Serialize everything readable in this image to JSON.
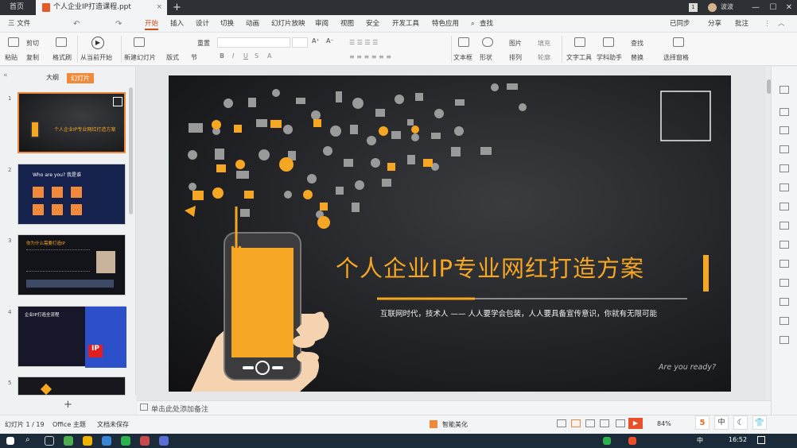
{
  "titlebar": {
    "home_tab": "首页",
    "doc_tab": "个人企业IP打造课程.ppt",
    "new_tab": "+",
    "page_num": "1",
    "user": "波波"
  },
  "menu": {
    "file": "三 文件",
    "items": [
      "开始",
      "插入",
      "设计",
      "切换",
      "动画",
      "幻灯片放映",
      "审阅",
      "视图",
      "安全",
      "开发工具",
      "特色应用"
    ],
    "search": "查找",
    "collab": "已同步",
    "share": "分享",
    "comment": "批注"
  },
  "toolbar": {
    "paste": "粘贴",
    "cut": "剪切",
    "copy": "复制",
    "format_painter": "格式刷",
    "play": "从当前开始",
    "new_slide": "新建幻灯片",
    "layout": "版式",
    "section": "节",
    "reset": "重置",
    "textbox": "文本框",
    "shape": "形状",
    "arrange": "排列",
    "picture": "图片",
    "fill": "填充",
    "outline": "轮廓",
    "text_tool": "文字工具",
    "find": "查找",
    "replace": "替换",
    "select": "选择窗格",
    "find_label": "查找",
    "font_size_up": "A⁺",
    "font_size_down": "A⁻"
  },
  "left": {
    "tab_outline": "大纲",
    "tab_slides": "幻灯片",
    "add": "+",
    "thumb2_title": "Who are you? 我是谁",
    "thumb3_title": "你为什么需要打造IP",
    "thumb4_title": "企业IP打造全流程"
  },
  "slide": {
    "title": "个人企业IP专业网红打造方案",
    "subtitle": "互联网时代，技术人 —— 人人要学会包装，人人要具备宣传意识，你就有无限可能",
    "footer": "Are you ready?"
  },
  "notes": {
    "placeholder": "单击此处添加备注"
  },
  "status": {
    "slide": "幻灯片 1 / 19",
    "theme": "Office 主题",
    "backup": "文档未保存",
    "smart": "智能美化",
    "zoom": "84%"
  },
  "taskbar": {
    "time": "16:52",
    "lang": "中"
  }
}
